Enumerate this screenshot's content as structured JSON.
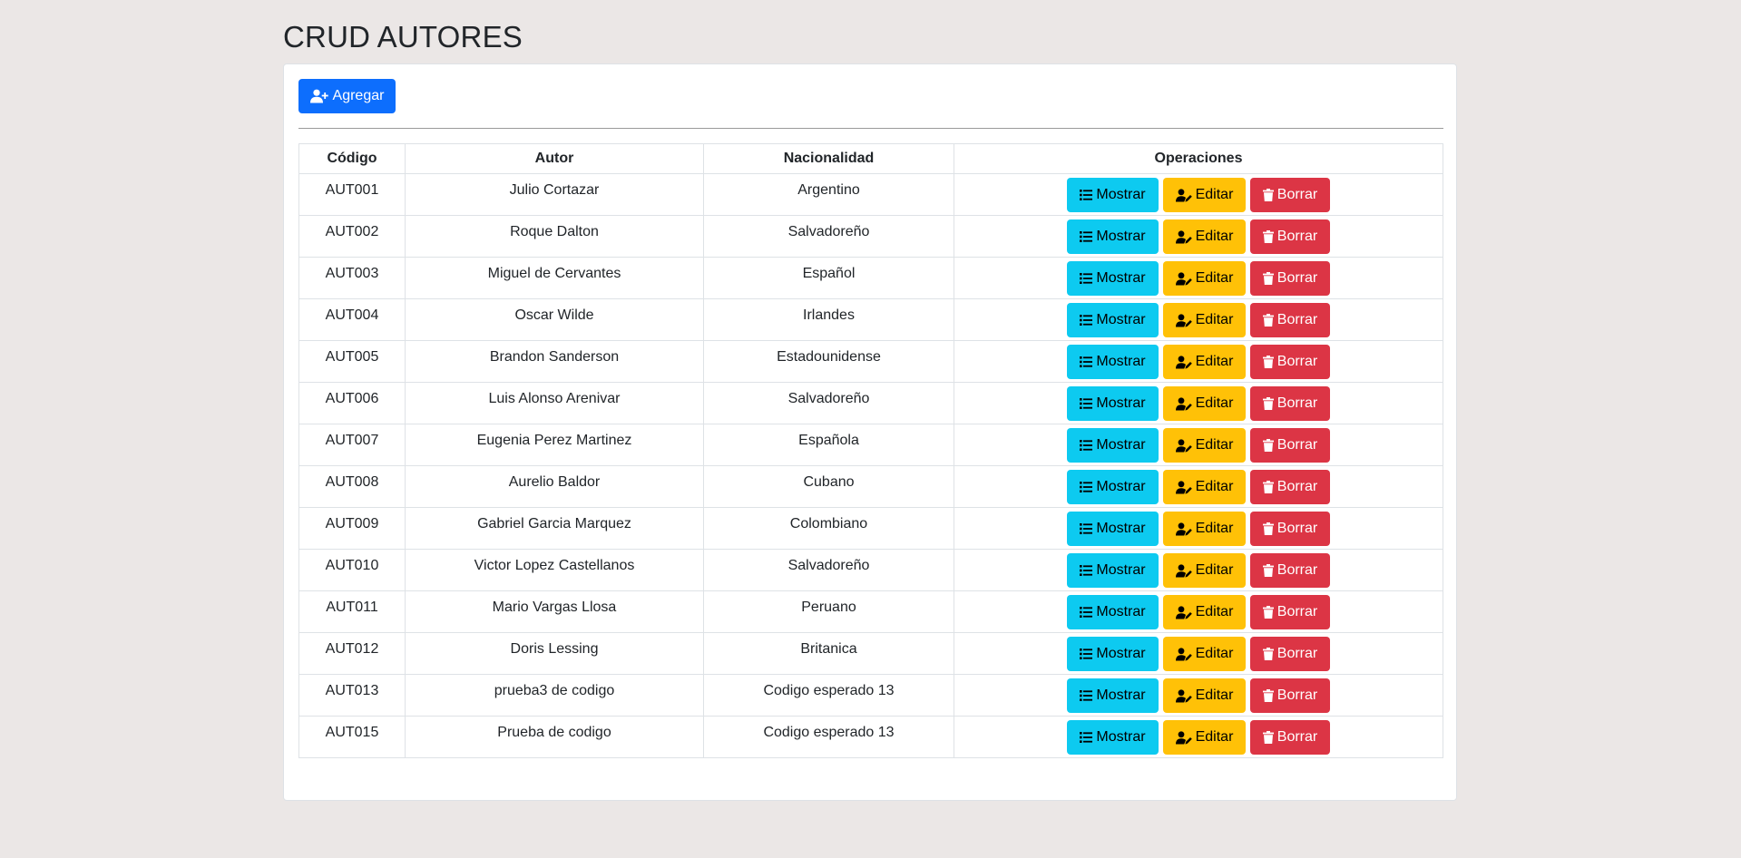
{
  "page": {
    "title": "CRUD AUTORES"
  },
  "toolbar": {
    "add_label": "Agregar",
    "add_icon": "user-plus-icon"
  },
  "table": {
    "headers": {
      "code": "Código",
      "author": "Autor",
      "nationality": "Nacionalidad",
      "operations": "Operaciones"
    },
    "actions": {
      "show": "Mostrar",
      "edit": "Editar",
      "delete": "Borrar"
    },
    "rows": [
      {
        "code": "AUT001",
        "author": "Julio Cortazar",
        "nationality": "Argentino"
      },
      {
        "code": "AUT002",
        "author": "Roque Dalton",
        "nationality": "Salvadoreño"
      },
      {
        "code": "AUT003",
        "author": "Miguel de Cervantes",
        "nationality": "Español"
      },
      {
        "code": "AUT004",
        "author": "Oscar Wilde",
        "nationality": "Irlandes"
      },
      {
        "code": "AUT005",
        "author": "Brandon Sanderson",
        "nationality": "Estadounidense"
      },
      {
        "code": "AUT006",
        "author": "Luis Alonso Arenivar",
        "nationality": "Salvadoreño"
      },
      {
        "code": "AUT007",
        "author": "Eugenia Perez Martinez",
        "nationality": "Española"
      },
      {
        "code": "AUT008",
        "author": "Aurelio Baldor",
        "nationality": "Cubano"
      },
      {
        "code": "AUT009",
        "author": "Gabriel Garcia Marquez",
        "nationality": "Colombiano"
      },
      {
        "code": "AUT010",
        "author": "Victor Lopez Castellanos",
        "nationality": "Salvadoreño"
      },
      {
        "code": "AUT011",
        "author": "Mario Vargas Llosa",
        "nationality": "Peruano"
      },
      {
        "code": "AUT012",
        "author": "Doris Lessing",
        "nationality": "Britanica"
      },
      {
        "code": "AUT013",
        "author": "prueba3 de codigo",
        "nationality": "Codigo esperado 13"
      },
      {
        "code": "AUT015",
        "author": "Prueba de codigo",
        "nationality": "Codigo esperado 13"
      }
    ]
  },
  "colors": {
    "background": "#ebe7e6",
    "primary": "#0d6efd",
    "info": "#0dcaf0",
    "warning": "#ffc107",
    "danger": "#dc3545"
  }
}
